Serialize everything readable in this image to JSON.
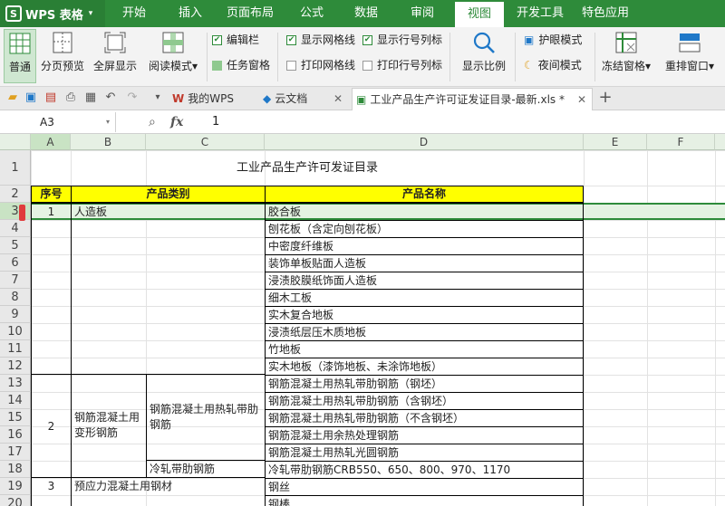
{
  "app": {
    "title": "WPS 表格"
  },
  "menu": [
    "开始",
    "插入",
    "页面布局",
    "公式",
    "数据",
    "审阅",
    "视图",
    "开发工具",
    "特色应用"
  ],
  "menu_active": "视图",
  "ribbon": {
    "normal": "普通",
    "page_break_preview": "分页预览",
    "full_screen": "全屏显示",
    "reading_mode": "阅读模式",
    "reading_mode_arrow": "▾",
    "edit_bar": "编辑栏",
    "task_pane": "任务窗格",
    "show_gridlines": "显示网格线",
    "show_headers": "显示行号列标",
    "print_gridlines": "打印网格线",
    "print_headers": "打印行号列标",
    "zoom": "显示比例",
    "eye_protection": "护眼模式",
    "night_mode": "夜间模式",
    "freeze_panes": "冻结窗格",
    "freeze_arrow": "▾",
    "rearrange_window": "重排窗口",
    "rearrange_arrow": "▾"
  },
  "tabs": [
    {
      "label": "我的WPS"
    },
    {
      "label": "云文档"
    },
    {
      "label": "工业产品生产许可证发证目录-最新.xls *"
    }
  ],
  "formula_bar": {
    "cell_ref": "A3",
    "fx": "fx",
    "value": "1"
  },
  "columns": [
    "A",
    "B",
    "C",
    "D",
    "E",
    "F",
    "G"
  ],
  "rows": [
    "1",
    "2",
    "3",
    "4",
    "5",
    "6",
    "7",
    "8",
    "9",
    "10",
    "11",
    "12",
    "13",
    "14",
    "15",
    "16",
    "17",
    "18",
    "19",
    "20"
  ],
  "sheet": {
    "title": "工业产品生产许可发证目录",
    "header_no": "序号",
    "header_category": "产品类别",
    "header_name": "产品名称",
    "no_1": "1",
    "cat_1": "人造板",
    "no_2": "2",
    "cat_2": "钢筋混凝土用变形钢筋",
    "sub_2a": "钢筋混凝土用热轧带肋钢筋",
    "sub_2b": "冷轧带肋钢筋",
    "no_3": "3",
    "cat_3": "预应力混凝土用钢材",
    "names": [
      "胶合板",
      "刨花板（含定向刨花板）",
      "中密度纤维板",
      "装饰单板贴面人造板",
      "浸渍胶膜纸饰面人造板",
      "细木工板",
      "实木复合地板",
      "浸渍纸层压木质地板",
      "竹地板",
      "实木地板（漆饰地板、未涂饰地板）",
      "钢筋混凝土用热轧带肋钢筋（钢坯）",
      "钢筋混凝土用热轧带肋钢筋（含钢坯）",
      "钢筋混凝土用热轧带肋钢筋（不含钢坯）",
      "钢筋混凝土用余热处理钢筋",
      "钢筋混凝土用热轧光圆钢筋",
      "冷轧带肋钢筋CRB550、650、800、970、1170",
      "钢丝",
      "钢棒"
    ]
  },
  "colors": {
    "brand": "#2e8b3a",
    "header_fill": "#ffff00",
    "selection": "#e4f2e2"
  }
}
